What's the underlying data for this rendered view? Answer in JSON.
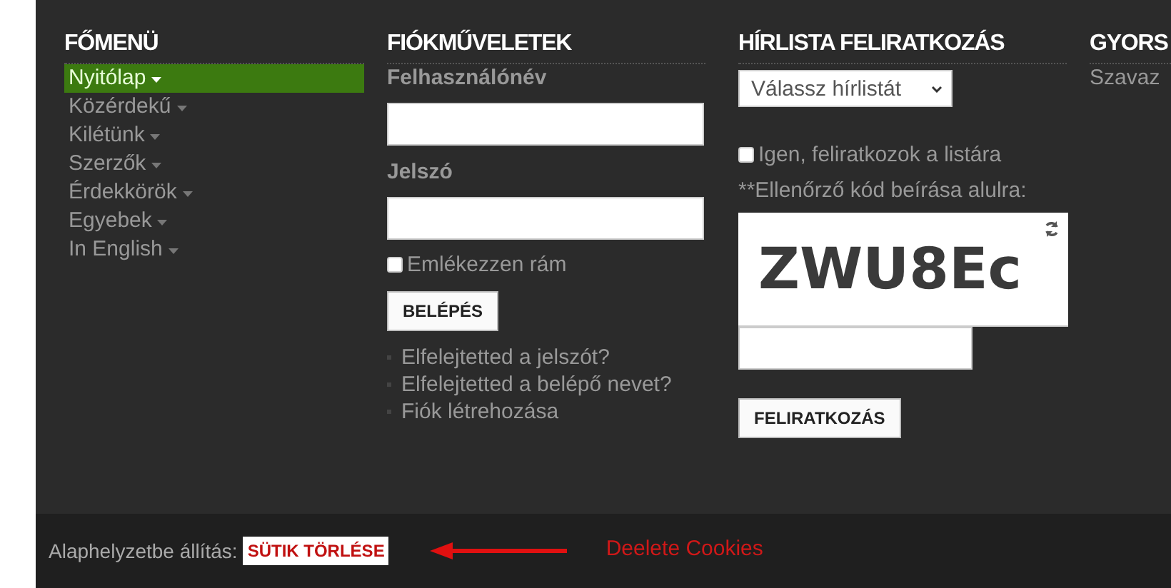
{
  "main_menu": {
    "title": "FŐMENÜ",
    "items": [
      {
        "label": "Nyitólap",
        "selected": true
      },
      {
        "label": "Közérdekű",
        "selected": false
      },
      {
        "label": "Kilétünk",
        "selected": false
      },
      {
        "label": "Szerzők",
        "selected": false
      },
      {
        "label": "Érdekkörök",
        "selected": false
      },
      {
        "label": "Egyebek",
        "selected": false
      },
      {
        "label": "In English",
        "selected": false
      }
    ]
  },
  "account": {
    "title": "FIÓKMŰVELETEK",
    "username_label": "Felhasználónév",
    "password_label": "Jelszó",
    "remember": {
      "label": "Emlékezzen rám",
      "checked": false
    },
    "login_button": "BELÉPÉS",
    "links": [
      "Elfelejtetted a jelszót?",
      "Elfelejtetted a belépő nevet?",
      "Fiók létrehozása"
    ]
  },
  "newsletter": {
    "title": "HÍRLISTA FELIRATKOZÁS",
    "select": "Válassz hírlistát",
    "consent": {
      "label": "Igen, feliratkozok a listára",
      "checked": false
    },
    "captcha_label": "**Ellenőrző kód beírása alulra:",
    "captcha_text": "ZWU8Ec",
    "subscribe_button": "FELIRATKOZÁS"
  },
  "quick": {
    "title": "GYORS",
    "items": [
      "Szavaz"
    ]
  },
  "footer": {
    "reset_label": "Alaphelyzetbe állítás:",
    "reset_button": "SÜTIK TÖRLÉSE",
    "annotation": "Deelete Cookies"
  }
}
